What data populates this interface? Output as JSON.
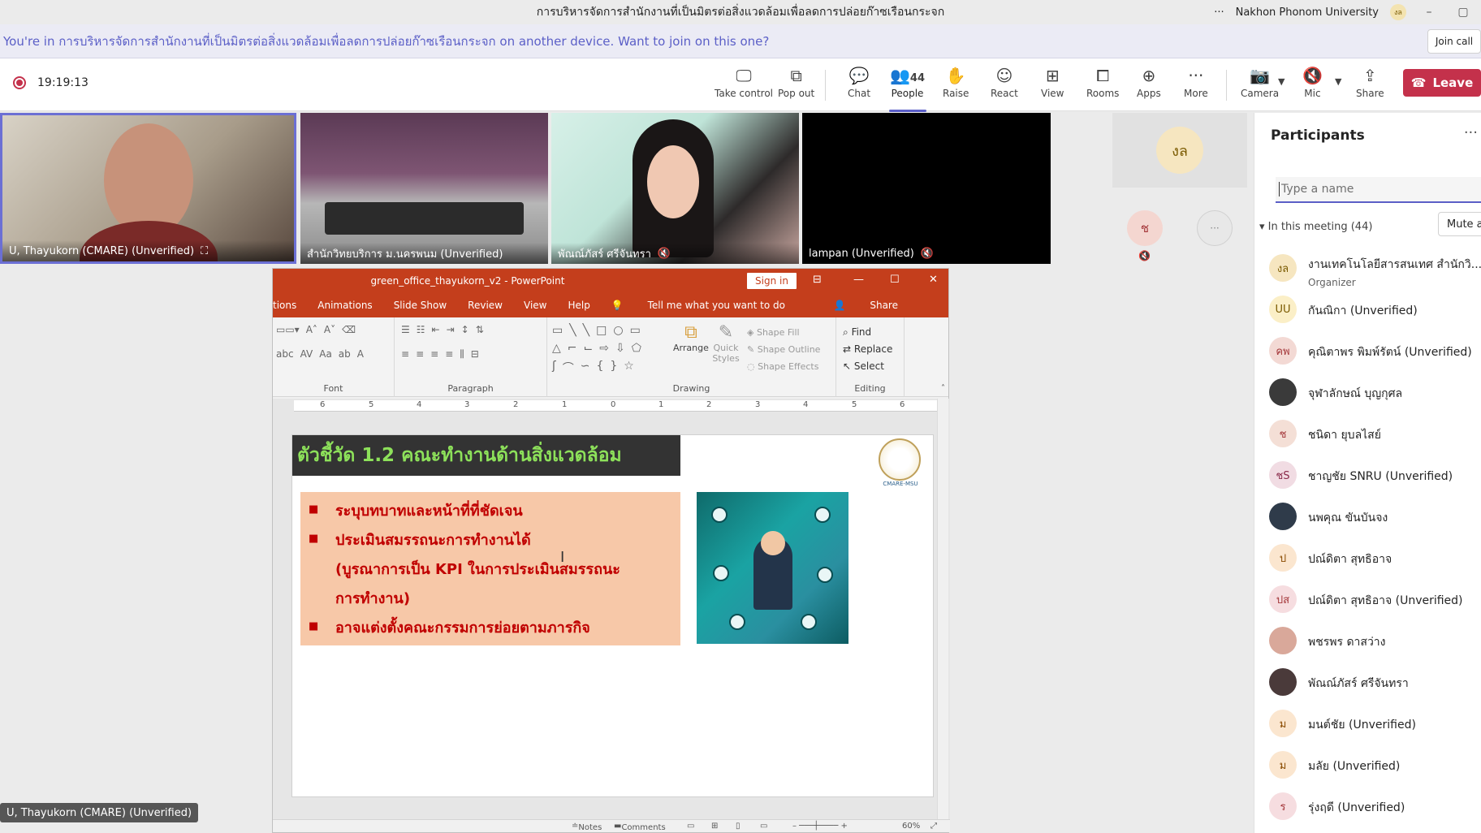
{
  "window": {
    "title": "การบริหารจัดการสำนักงานที่เป็นมิตรต่อสิ่งแวดล้อมเพื่อลดการปล่อยก๊าซเรือนกระจก",
    "org": "Nakhon Phonom University",
    "user_initials": "งล"
  },
  "banner": {
    "message": "You're in การบริหารจัดการสำนักงานที่เป็นมิตรต่อสิ่งแวดล้อมเพื่อลดการปล่อยก๊าซเรือนกระจก on another device. Want to join on this one?",
    "join_label": "Join call"
  },
  "toolbar": {
    "timer": "19:19:13",
    "take_control": "Take control",
    "pop_out": "Pop out",
    "chat": "Chat",
    "people": "People",
    "people_count": "44",
    "raise": "Raise",
    "react": "React",
    "view": "View",
    "rooms": "Rooms",
    "apps": "Apps",
    "more": "More",
    "camera": "Camera",
    "mic": "Mic",
    "share": "Share",
    "leave": "Leave"
  },
  "videos": [
    {
      "name": "U, Thayukorn (CMARE) (Unverified)"
    },
    {
      "name": "สำนักวิทยบริการ ม.นครพนม (Unverified)"
    },
    {
      "name": "พัณณ์ภัสร์   ศรีจันทรา"
    },
    {
      "name": "lampan (Unverified)"
    }
  ],
  "mini_tiles": {
    "a_initials": "งล",
    "b_initials": "ช",
    "c_initials": "···"
  },
  "self_label": "U, Thayukorn (CMARE) (Unverified)",
  "ppt": {
    "file_title": "green_office_thayukorn_v2  -  PowerPoint",
    "sign_in": "Sign in",
    "menu": [
      "tions",
      "Animations",
      "Slide Show",
      "Review",
      "View",
      "Help"
    ],
    "tell_me": "Tell me what you want to do",
    "share": "Share",
    "groups": {
      "font": "Font",
      "paragraph": "Paragraph",
      "drawing": "Drawing",
      "editing": "Editing"
    },
    "drawing_items": {
      "arrange": "Arrange",
      "quick_styles": "Quick Styles",
      "shape_fill": "Shape Fill",
      "shape_outline": "Shape Outline",
      "shape_effects": "Shape Effects"
    },
    "editing_items": {
      "find": "Find",
      "replace": "Replace",
      "select": "Select"
    },
    "ruler_ticks": [
      "6",
      "5",
      "4",
      "3",
      "2",
      "1",
      "0",
      "1",
      "2",
      "3",
      "4",
      "5",
      "6"
    ],
    "status": {
      "notes": "Notes",
      "comments": "Comments",
      "zoom": "60%"
    }
  },
  "slide": {
    "title": "ตัวชี้วัด 1.2 คณะทำงานด้านสิ่งแวดล้อม",
    "bullets": [
      "ระบุบทบาทและหน้าที่ที่ชัดเจน",
      "ประเมินสมรรถนะการทำงานได้",
      "อาจแต่งตั้งคณะกรรมการย่อยตามภารกิจ"
    ],
    "sub_line1": "(บูรณาการเป็น KPI ในการประเมินสมรรถนะ",
    "sub_line2": "การทำงาน)",
    "logo_text": "CMARE-MSU"
  },
  "participants": {
    "title": "Participants",
    "search_placeholder": "Type a name",
    "in_meeting": "In this meeting (44)",
    "mute_all": "Mute a",
    "list": [
      {
        "initials": "งล",
        "name": "งานเทคโนโลยีสารสนเทศ สำนักวิ...",
        "role": "Organizer",
        "bg": "#f6e6c0",
        "fg": "#7a5a00"
      },
      {
        "initials": "UU",
        "name": "กันณิกา (Unverified)",
        "role": "",
        "bg": "#fbefc7",
        "fg": "#7a5a00"
      },
      {
        "initials": "คพ",
        "name": "คุณิตาพร พิมพ์รัตน์ (Unverified)",
        "role": "",
        "bg": "#f3d9d4",
        "fg": "#a4373a"
      },
      {
        "initials": "",
        "name": "จุฬาลักษณ์ บุญกุศล",
        "role": "",
        "bg": "#3a3a3a",
        "fg": "#ffffff"
      },
      {
        "initials": "ช",
        "name": "ชนิดา   ยุบลไสย์",
        "role": "",
        "bg": "#f4dfd6",
        "fg": "#a4373a"
      },
      {
        "initials": "ชS",
        "name": "ชาญชัย SNRU (Unverified)",
        "role": "",
        "bg": "#f1dce3",
        "fg": "#8a2a4a"
      },
      {
        "initials": "",
        "name": "นพคุณ   ขันบันจง",
        "role": "",
        "bg": "#2f3b4a",
        "fg": "#ffffff"
      },
      {
        "initials": "ป",
        "name": "ปณ์ดิตา   สุทธิอาจ",
        "role": "",
        "bg": "#fbe6cf",
        "fg": "#8a4b00"
      },
      {
        "initials": "ปส",
        "name": "ปณ์ดิตา สุทธิอาจ (Unverified)",
        "role": "",
        "bg": "#f6dde0",
        "fg": "#a4373a"
      },
      {
        "initials": "",
        "name": "พชรพร   ดาสว่าง",
        "role": "",
        "bg": "#d9a89a",
        "fg": "#ffffff"
      },
      {
        "initials": "",
        "name": "พัณณ์ภัสร์   ศรีจันทรา",
        "role": "",
        "bg": "#4a3a3a",
        "fg": "#ffffff"
      },
      {
        "initials": "ม",
        "name": "มนต์ชัย (Unverified)",
        "role": "",
        "bg": "#fbe6cf",
        "fg": "#8a4b00"
      },
      {
        "initials": "ม",
        "name": "มลัย (Unverified)",
        "role": "",
        "bg": "#fbe6cf",
        "fg": "#8a4b00"
      },
      {
        "initials": "ร",
        "name": "รุ่งฤดี (Unverified)",
        "role": "",
        "bg": "#f6dde0",
        "fg": "#a4373a"
      }
    ]
  },
  "colors": {
    "accent": "#5b5fc7",
    "leave_red": "#c4314b",
    "ppt_orange": "#c43e1c",
    "slide_green": "#8de15a",
    "slide_red": "#c00000"
  }
}
